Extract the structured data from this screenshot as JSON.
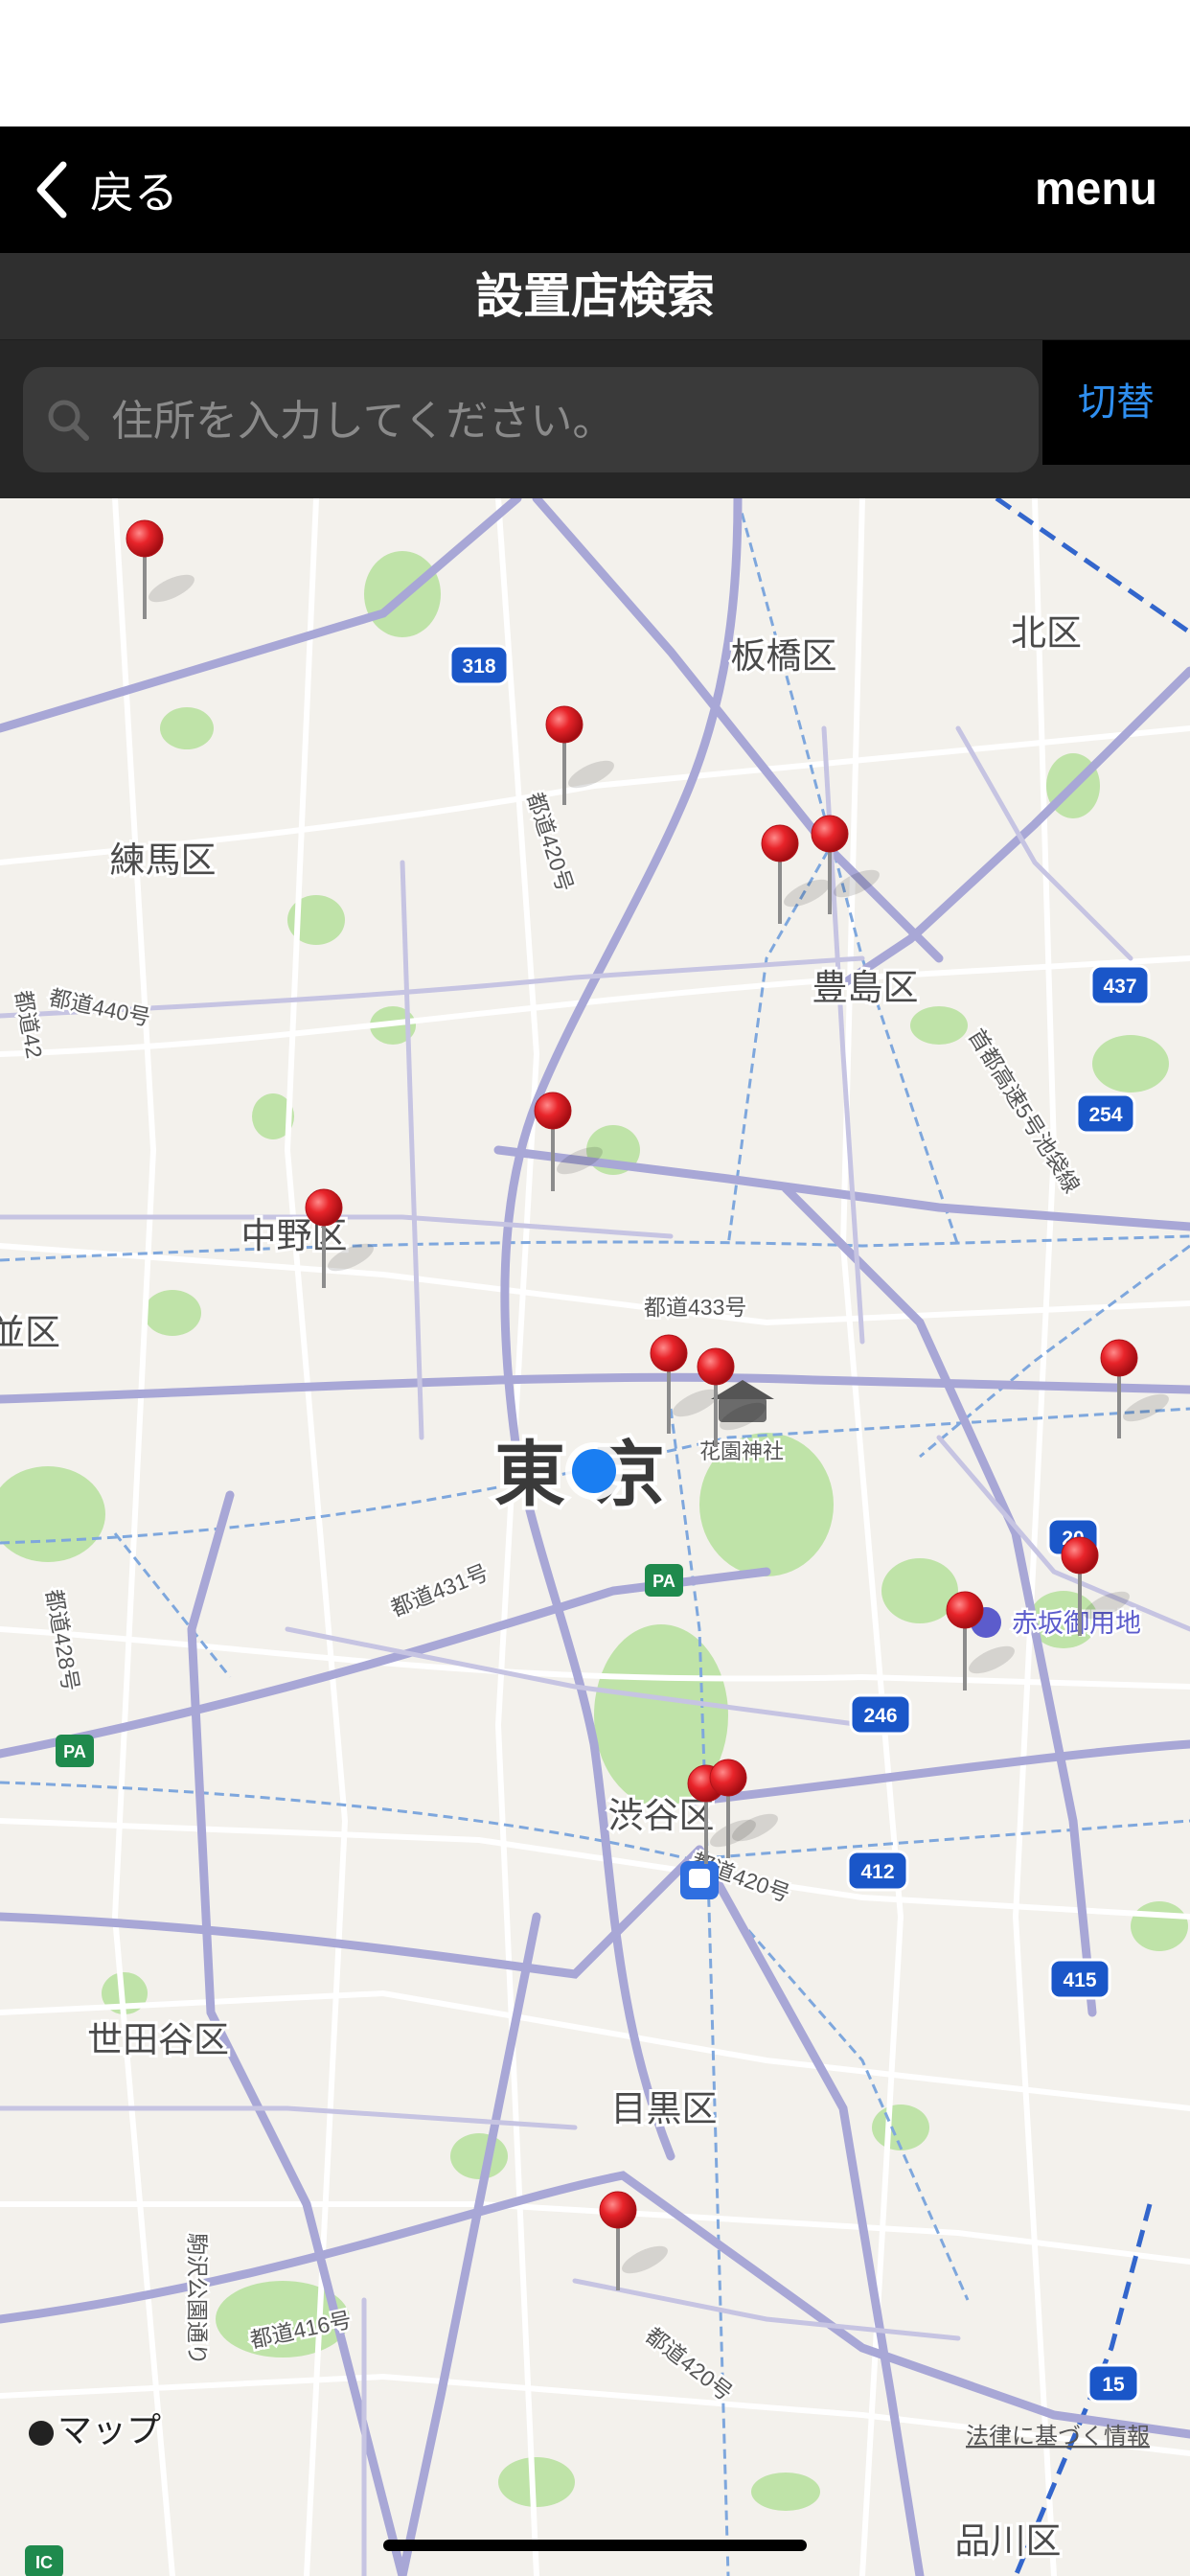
{
  "nav": {
    "back_label": "戻る",
    "menu_label": "menu"
  },
  "title": "設置店検索",
  "search": {
    "placeholder": "住所を入力してください。",
    "value": "",
    "toggle_label": "切替"
  },
  "map": {
    "ward_labels": [
      "板橋区",
      "北区",
      "練馬区",
      "豊島区",
      "中野区",
      "並区",
      "世田谷区",
      "渋谷区",
      "目黒区",
      "品川区"
    ],
    "city_label": "東京",
    "poi_labels": [
      "花園神社",
      "赤坂御用地"
    ],
    "road_labels": [
      "都道440号",
      "都道420号",
      "都道433号",
      "都道431号",
      "都道416号",
      "都道420号",
      "首都高速5号池袋線",
      "駒沢公園通り",
      "都道428号",
      "都道42"
    ],
    "route_shields": [
      "318",
      "437",
      "254",
      "20",
      "246",
      "412",
      "415",
      "15"
    ],
    "badges": [
      "PA",
      "PA",
      "IC"
    ],
    "attribution": "マップ",
    "legal_link": "法律に基づく情報",
    "pin_color": "#e8242a",
    "user_location_color": "#1a7ef2"
  }
}
